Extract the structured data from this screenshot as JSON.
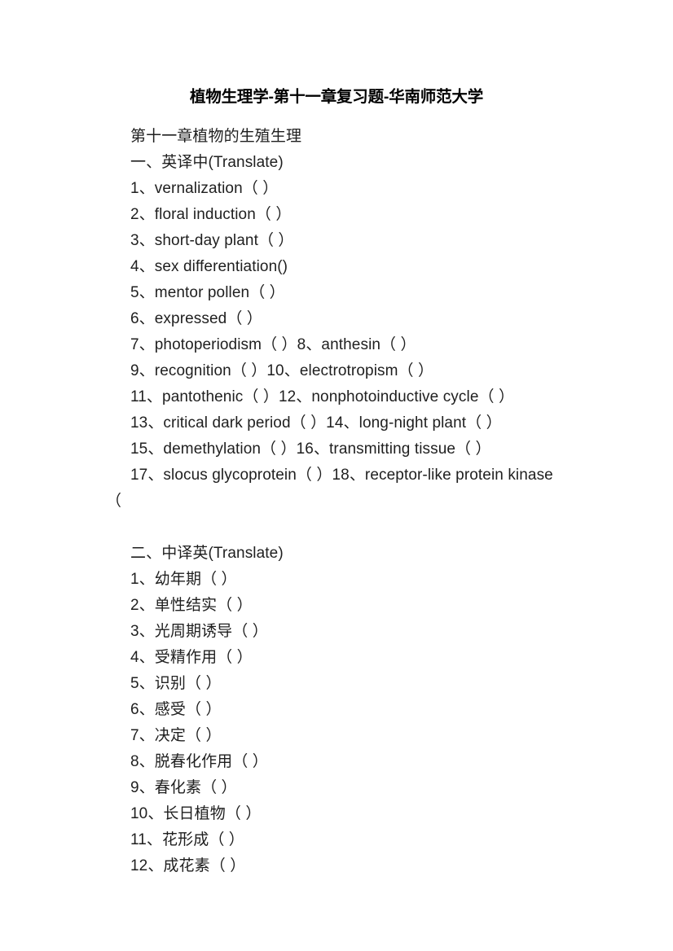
{
  "document": {
    "title": "植物生理学-第十一章复习题-华南师范大学",
    "chapter_heading": "第十一章植物的生殖生理",
    "sections": [
      {
        "heading": "一、英译中(Translate)",
        "lines": [
          "1、vernalization（ ）",
          "2、floral induction（ ）",
          "3、short-day plant（ ）",
          "4、sex differentiation()",
          "5、mentor pollen（ ）",
          "6、expressed（ ）",
          "7、photoperiodism（ ）8、anthesin（ ）",
          "9、recognition（ ）10、electrotropism（ ）",
          "11、pantothenic（ ）12、nonphotoinductive cycle（ ）",
          "13、critical dark period（ ）14、long-night plant（ ）",
          "15、demethylation（ ）16、transmitting tissue（ ）",
          "17、slocus glycoprotein（ ）18、receptor-like protein kinase"
        ],
        "wrapped_fragment": "（"
      },
      {
        "heading": "二、中译英(Translate)",
        "lines": [
          "1、幼年期（ ）",
          "2、单性结实（ ）",
          "3、光周期诱导（ ）",
          "4、受精作用（ ）",
          "5、识别（ ）",
          "6、感受（ ）",
          "7、决定（ ）",
          "8、脱春化作用（ ）",
          "9、春化素（ ）",
          "10、长日植物（ ）",
          "11、花形成（ ）",
          "12、成花素（ ）"
        ]
      }
    ]
  }
}
